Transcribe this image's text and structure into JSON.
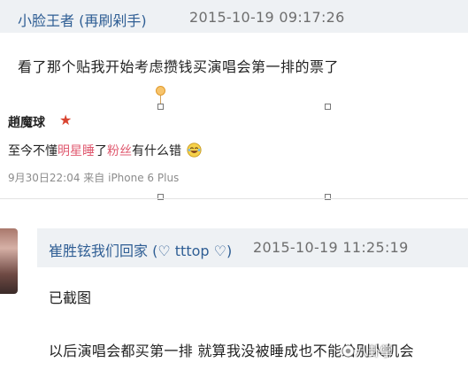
{
  "top_reply": {
    "username": "小脸王者",
    "user_suffix": "(再刷剁手)",
    "datetime": "2015-10-19 09:17:26",
    "text": "看了那个贴我开始考虑攒钱买演唱会第一排的票了"
  },
  "embedded_post": {
    "username": "趙魔球",
    "text_before": "至今不懂",
    "highlight_1": "明星睡",
    "text_middle": "了",
    "highlight_2": "粉丝",
    "text_after": "有什么错",
    "meta": "9月30日22:04 来自 iPhone 6 Plus"
  },
  "second_reply": {
    "username": "崔胜铉我们回家",
    "user_suffix": "(♡ tttop ♡)",
    "datetime": "2015-10-19 11:25:19",
    "text_1": "已截图",
    "text_2": "以后演唱会都买第一排 就算我没被睡成也不能给别人机会"
  },
  "watermark": {
    "text": "八卦掌"
  },
  "icons": {
    "star": "red-star-icon",
    "laugh": "laughing-crying-emoji-icon",
    "rotate_handle": "rotate-handle-icon"
  },
  "colors": {
    "username": "#2f5e94",
    "highlight": "#e05a70",
    "header_bg": "#eef1f4"
  }
}
